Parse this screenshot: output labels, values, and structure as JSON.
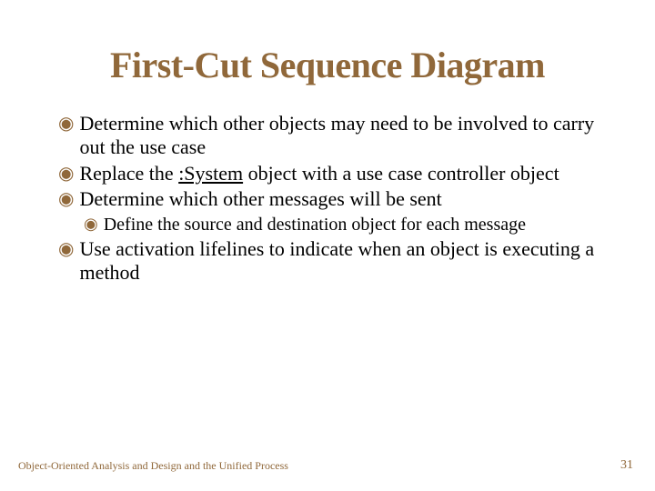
{
  "title": "First-Cut Sequence Diagram",
  "bullets": [
    {
      "text": "Determine which other objects may need to be involved to carry out the use case"
    },
    {
      "prefix": "Replace the ",
      "underlined": ":System",
      "suffix": " object with a use case controller object"
    },
    {
      "text": "Determine which other messages will be sent"
    },
    {
      "sub": true,
      "text": "Define the source and destination object for each message"
    },
    {
      "text": "Use activation lifelines to indicate when an object is executing a method"
    }
  ],
  "footer": "Object-Oriented Analysis and Design and the Unified Process",
  "page_number": "31"
}
